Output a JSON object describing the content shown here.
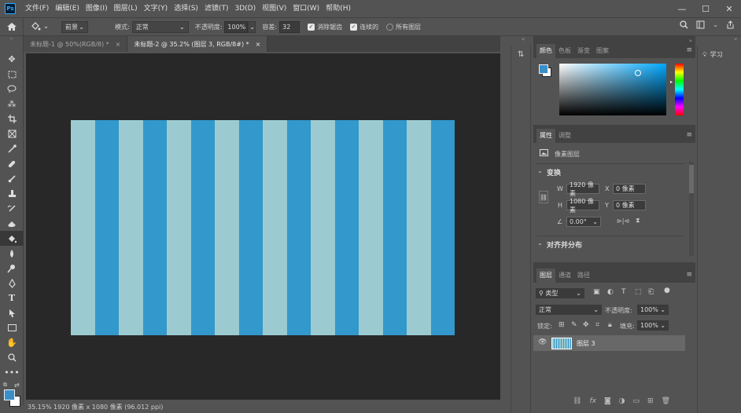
{
  "app": {
    "logo": "Ps"
  },
  "menu": [
    "文件(F)",
    "编辑(E)",
    "图像(I)",
    "图层(L)",
    "文字(Y)",
    "选择(S)",
    "滤镜(T)",
    "3D(D)",
    "视图(V)",
    "窗口(W)",
    "帮助(H)"
  ],
  "window_controls": {
    "minimize": "—",
    "maximize": "☐",
    "close": "✕"
  },
  "options": {
    "fill_source": "前景",
    "mode_label": "模式:",
    "mode_value": "正常",
    "opacity_label": "不透明度:",
    "opacity_value": "100%",
    "tolerance_label": "容差:",
    "tolerance_value": "32",
    "antialias_label": "消除锯齿",
    "contiguous_label": "连续的",
    "all_layers_label": "所有图层"
  },
  "tabs": [
    {
      "label": "未标题-1 @ 50%(RGB/8) *",
      "close": "×"
    },
    {
      "label": "未标题-2 @ 35.2% (图层 3, RGB/8#) *",
      "close": "×"
    }
  ],
  "status": "35.15%  1920 像素 x 1080 像素 (96.012 ppi)",
  "document": {
    "stripe_colors": [
      "#9bcbd0",
      "#3398cc",
      "#9bcbd0",
      "#3398cc",
      "#9bcbd0",
      "#3398cc",
      "#9bcbd0",
      "#3398cc",
      "#9bcbd0",
      "#3398cc",
      "#9bcbd0",
      "#3398cc",
      "#9bcbd0",
      "#3398cc",
      "#9bcbd0",
      "#3398cc"
    ]
  },
  "color_panel": {
    "tabs": [
      "颜色",
      "色板",
      "渐变",
      "图案"
    ],
    "foreground": "#3a8fc8",
    "background": "#ffffff"
  },
  "properties_panel": {
    "tabs": [
      "属性",
      "调整"
    ],
    "layer_type": "像素图层",
    "transform_title": "变换",
    "w_label": "W",
    "w_value": "1920 像素",
    "h_label": "H",
    "h_value": "1080 像素",
    "x_label": "X",
    "x_value": "0 像素",
    "y_label": "Y",
    "y_value": "0 像素",
    "angle_value": "0.00°",
    "align_title": "对齐并分布"
  },
  "layers_panel": {
    "tabs": [
      "图层",
      "通道",
      "路径"
    ],
    "filter_kind": "类型",
    "blend_mode": "正常",
    "opacity_label": "不透明度:",
    "opacity_value": "100%",
    "lock_label": "锁定:",
    "fill_label": "填充:",
    "fill_value": "100%",
    "layers": [
      {
        "name": "图层 3"
      }
    ]
  },
  "learn": {
    "label": "学习"
  }
}
